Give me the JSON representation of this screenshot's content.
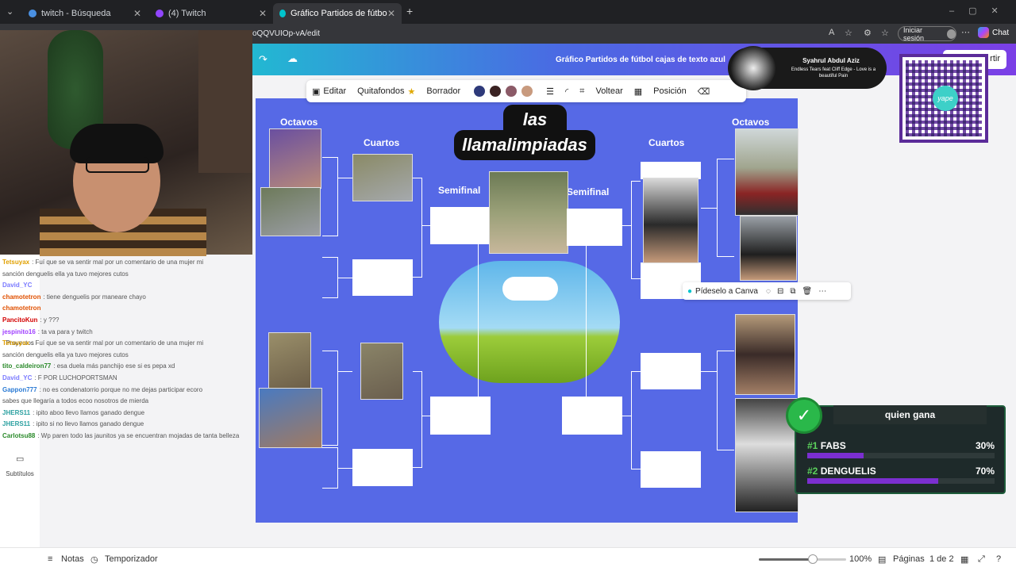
{
  "browser": {
    "tabs": [
      {
        "label": "twitch - Búsqueda",
        "favicon_color": "#4a90e2"
      },
      {
        "label": "(4) Twitch",
        "favicon_color": "#9146ff"
      },
      {
        "label": "Gráfico Partidos de fútbol cajas de",
        "favicon_color": "#00c4cc"
      }
    ],
    "url": "oQQVUIOp-vA/edit",
    "signin_label": "Iniciar sesión",
    "chat_label": "Chat"
  },
  "canva": {
    "doc_title": "Gráfico Partidos de fútbol cajas de texto azul",
    "share_label": "rtir",
    "toolbar": {
      "edit": "Editar",
      "bg_remover": "Quitafondos",
      "eraser": "Borrador",
      "flip": "Voltear",
      "position": "Posición",
      "swatches": [
        "#2e3a7a",
        "#3a2222",
        "#8b5a67",
        "#c89a7e"
      ]
    },
    "left_rail": [
      "Proyectos",
      "Subtítulos"
    ],
    "popup": {
      "ask": "Pídeselo a Canva"
    }
  },
  "design": {
    "title_line1": "las",
    "title_line2": "llamalimpiadas",
    "labels": {
      "octavos_left": "Octavos",
      "cuartos_left": "Cuartos",
      "semifinal_left": "Semifinal",
      "semifinal_right": "Semifinal",
      "cuartos_right": "Cuartos",
      "octavos_right": "Octavos"
    },
    "bg_color": "#5669e6"
  },
  "chat": [
    {
      "user": "Tetsuyax",
      "text": ": Fuí que se va sentir mal por un comentario de una mujer mi",
      "color": "#e0a000"
    },
    {
      "user": "",
      "text": "sanción denguelis ella ya tuvo mejores cutos",
      "color": "#888"
    },
    {
      "user": "David_YC",
      "text": "",
      "color": "#7a7aff"
    },
    {
      "user": "chamotetron",
      "text": ": tiene denguelis por maneare chayo",
      "color": "#e05000"
    },
    {
      "user": "chamotetron",
      "text": "",
      "color": "#e05000"
    },
    {
      "user": "PancitoKun",
      "text": ": y ???",
      "color": "#d40000"
    },
    {
      "user": "jespinito16",
      "text": ": ta va para y twitch",
      "color": "#a040ff"
    },
    {
      "user": "Tetsuyax",
      "text": ": Fuí que se va sentir mal por un comentario de una mujer mi",
      "color": "#e0a000"
    },
    {
      "user": "",
      "text": "sanción denguelis ella ya tuvo mejores cutos",
      "color": "#888"
    },
    {
      "user": "tito_caldeiron77",
      "text": ": esa duela más panchijo ese si es pepa xd",
      "color": "#2a8a2a"
    },
    {
      "user": "David_YC",
      "text": ": F POR LUCHOPORTSMAN",
      "color": "#7a7aff"
    },
    {
      "user": "Gappon777",
      "text": ": no es condenatorrio porque no me dejas participar ecoro",
      "color": "#2a7ad4"
    },
    {
      "user": "",
      "text": "sabes que llegaría a todos ecoo nosotros de mierda",
      "color": "#888"
    },
    {
      "user": "JHERS11",
      "text": ": ipito aboo llevo llamos ganado dengue",
      "color": "#2aa0a0"
    },
    {
      "user": "JHERS11",
      "text": ": ipito si no llevo llamos ganado dengue",
      "color": "#2aa0a0"
    },
    {
      "user": "Carlotsu88",
      "text": ": Wp paren todo las jaunitos ya se encuentran mojadas de tanta belleza",
      "color": "#2a8a2a"
    }
  ],
  "now_playing": {
    "artist": "Syahrul Abdul Aziz",
    "song": "Endless Tears feat Cliff Edge - Love is a beautiful Pain"
  },
  "qr": {
    "brand": "yape"
  },
  "poll": {
    "title": "quien gana",
    "options": [
      {
        "rank": "#1",
        "name": "FABS",
        "percent_label": "30%",
        "value": 0.3
      },
      {
        "rank": "#2",
        "name": "DENGUELIS",
        "percent_label": "70%",
        "value": 0.7
      }
    ]
  },
  "bottom": {
    "notes": "Notas",
    "timer": "Temporizador",
    "zoom": "100%",
    "pages_label": "Páginas",
    "page_counter": "1 de 2",
    "zoom_value": 0.62
  }
}
